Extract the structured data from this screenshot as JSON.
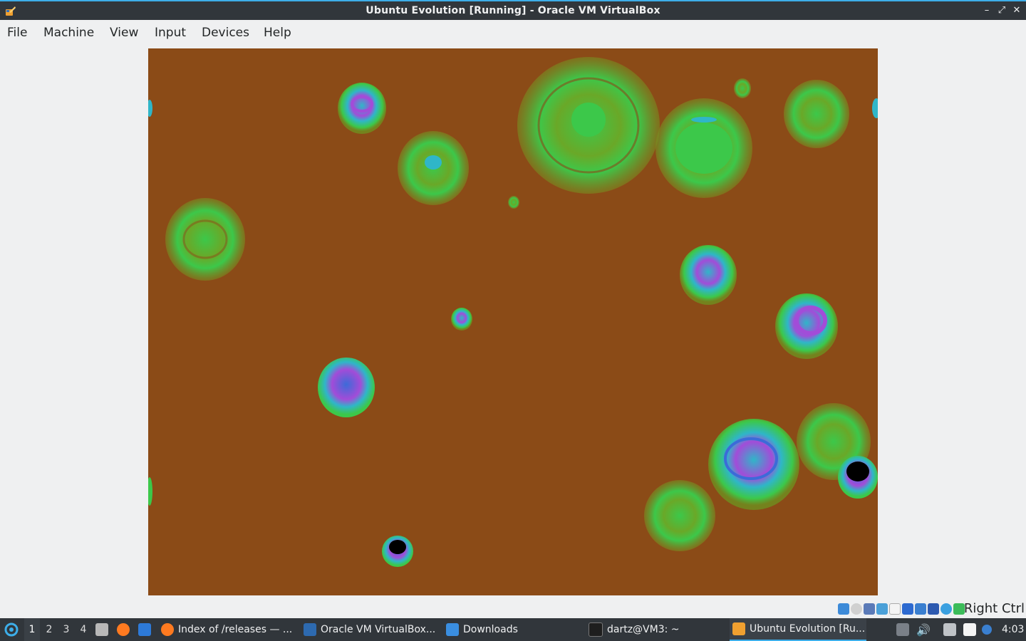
{
  "window": {
    "title": "Ubuntu Evolution [Running] - Oracle VM VirtualBox",
    "minimize_glyph": "–",
    "maximize_glyph": "⤢",
    "close_glyph": "✕"
  },
  "menu": {
    "items": [
      "File",
      "Machine",
      "View",
      "Input",
      "Devices",
      "Help"
    ]
  },
  "guest": {
    "background_color": "#8b4b17",
    "bubble_colors": [
      "#5aa52a",
      "#3cc84a",
      "#2fb6c8",
      "#a24cd8",
      "#3c6bd8",
      "#000000"
    ]
  },
  "status": {
    "host_key": "Right Ctrl",
    "indicator_icons": [
      "hard-disk-icon",
      "optical-drive-icon",
      "audio-icon",
      "network-icon",
      "usb-icon",
      "shared-folders-icon",
      "display-icon",
      "video-capture-icon",
      "cpu-icon",
      "mouse-integration-icon",
      "keyboard-icon"
    ]
  },
  "taskbar": {
    "desktops": [
      "1",
      "2",
      "3",
      "4"
    ],
    "active_desktop": "1",
    "tasks": [
      {
        "label": "Index of /releases — ...",
        "icon": "firefox-icon"
      },
      {
        "label": "Oracle VM VirtualBox...",
        "icon": "virtualbox-manager-icon"
      },
      {
        "label": "Downloads",
        "icon": "folder-icon"
      },
      {
        "label": "dartz@VM3: ~",
        "icon": "terminal-icon"
      },
      {
        "label": "Ubuntu Evolution [Ru...",
        "icon": "virtualbox-vm-icon"
      }
    ],
    "clock": "4:03"
  }
}
